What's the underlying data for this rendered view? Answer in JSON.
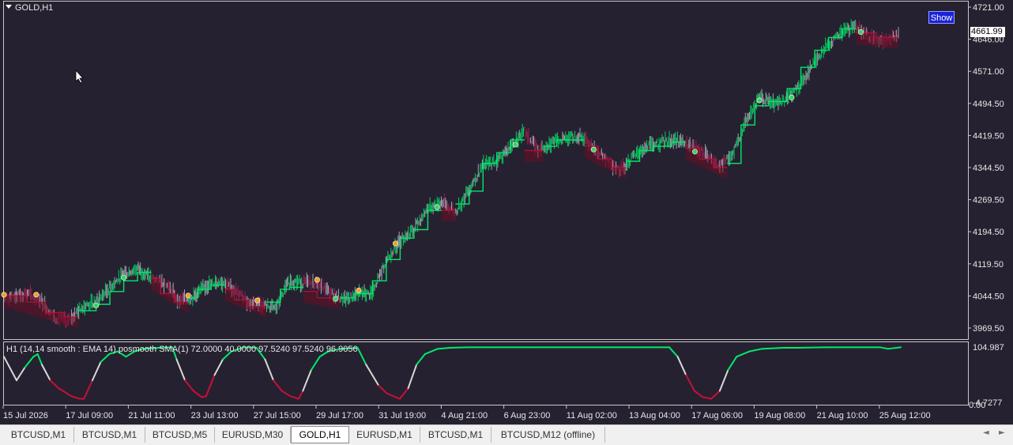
{
  "chart": {
    "symbol_label": "GOLD,H1",
    "indicator_label": "H1  (14,14 smooth : EMA  14) posmooth SMA(1) 72.0000 40.0000 97.5240 97.5240 96.9056",
    "show_button": "Show",
    "current_price": "4661.99",
    "y_ticks": [
      "4721.00",
      "4646.00",
      "4571.00",
      "4494.50",
      "4419.50",
      "4344.50",
      "4269.50",
      "4194.50",
      "4119.50",
      "4044.50",
      "3969.50"
    ],
    "sub_ticks": [
      "104.987",
      "-4.7277"
    ],
    "sub_zero": "0.00",
    "x_ticks": [
      "15 Jul 2026",
      "17 Jul 09:00",
      "21 Jul 11:00",
      "23 Jul 13:00",
      "27 Jul 15:00",
      "29 Jul 17:00",
      "31 Jul 19:00",
      "4 Aug 21:00",
      "6 Aug 23:00",
      "11 Aug 02:00",
      "13 Aug 04:00",
      "17 Aug 06:00",
      "19 Aug 08:00",
      "21 Aug 10:00",
      "25 Aug 12:00"
    ],
    "colors": {
      "background": "#262130",
      "up": "#00e86a",
      "down": "#c8103a",
      "neutral": "#b8b8c8",
      "signal_buy": "#40d060",
      "signal_sell": "#f0a020"
    }
  },
  "chart_data": {
    "type": "line",
    "y_range": [
      3950,
      4730
    ],
    "price_path": [
      [
        0,
        4040
      ],
      [
        5,
        4050
      ],
      [
        8,
        4035
      ],
      [
        11,
        3995
      ],
      [
        14,
        3985
      ],
      [
        17,
        4020
      ],
      [
        20,
        4030
      ],
      [
        23,
        4065
      ],
      [
        26,
        4095
      ],
      [
        29,
        4110
      ],
      [
        32,
        4085
      ],
      [
        35,
        4075
      ],
      [
        38,
        4035
      ],
      [
        41,
        4040
      ],
      [
        44,
        4070
      ],
      [
        47,
        4080
      ],
      [
        50,
        4060
      ],
      [
        53,
        4030
      ],
      [
        56,
        4025
      ],
      [
        59,
        4015
      ],
      [
        62,
        4080
      ],
      [
        65,
        4075
      ],
      [
        68,
        4075
      ],
      [
        71,
        4050
      ],
      [
        74,
        4035
      ],
      [
        77,
        4050
      ],
      [
        80,
        4050
      ],
      [
        83,
        4130
      ],
      [
        86,
        4175
      ],
      [
        89,
        4200
      ],
      [
        92,
        4250
      ],
      [
        95,
        4265
      ],
      [
        98,
        4240
      ],
      [
        101,
        4295
      ],
      [
        104,
        4350
      ],
      [
        107,
        4360
      ],
      [
        110,
        4395
      ],
      [
        113,
        4430
      ],
      [
        116,
        4385
      ],
      [
        119,
        4405
      ],
      [
        122,
        4415
      ],
      [
        125,
        4420
      ],
      [
        128,
        4395
      ],
      [
        131,
        4360
      ],
      [
        134,
        4340
      ],
      [
        137,
        4375
      ],
      [
        140,
        4395
      ],
      [
        143,
        4405
      ],
      [
        146,
        4410
      ],
      [
        149,
        4395
      ],
      [
        152,
        4380
      ],
      [
        155,
        4350
      ],
      [
        158,
        4370
      ],
      [
        161,
        4450
      ],
      [
        164,
        4510
      ],
      [
        167,
        4495
      ],
      [
        170,
        4505
      ],
      [
        173,
        4540
      ],
      [
        176,
        4595
      ],
      [
        179,
        4635
      ],
      [
        182,
        4660
      ],
      [
        185,
        4680
      ],
      [
        188,
        4650
      ],
      [
        191,
        4640
      ],
      [
        194,
        4655
      ]
    ],
    "trail_segments": [
      {
        "color": "down",
        "points": [
          [
            0,
            4045
          ],
          [
            5,
            4045
          ],
          [
            5,
            4030
          ],
          [
            9,
            4030
          ],
          [
            9,
            4005
          ],
          [
            13,
            4005
          ],
          [
            13,
            3995
          ],
          [
            16,
            3995
          ]
        ]
      },
      {
        "color": "up",
        "points": [
          [
            16,
            4010
          ],
          [
            20,
            4010
          ],
          [
            20,
            4025
          ],
          [
            23,
            4025
          ],
          [
            23,
            4055
          ],
          [
            26,
            4055
          ],
          [
            26,
            4080
          ],
          [
            29,
            4080
          ],
          [
            29,
            4100
          ],
          [
            32,
            4100
          ]
        ]
      },
      {
        "color": "down",
        "points": [
          [
            32,
            4085
          ],
          [
            34,
            4085
          ],
          [
            34,
            4050
          ],
          [
            37,
            4050
          ],
          [
            37,
            4030
          ],
          [
            40,
            4030
          ]
        ]
      },
      {
        "color": "up",
        "points": [
          [
            40,
            4040
          ],
          [
            42,
            4040
          ],
          [
            42,
            4060
          ],
          [
            45,
            4060
          ],
          [
            45,
            4070
          ],
          [
            48,
            4070
          ]
        ]
      },
      {
        "color": "down",
        "points": [
          [
            48,
            4060
          ],
          [
            50,
            4060
          ],
          [
            50,
            4035
          ],
          [
            53,
            4035
          ],
          [
            53,
            4020
          ],
          [
            57,
            4020
          ]
        ]
      },
      {
        "color": "up",
        "points": [
          [
            57,
            4030
          ],
          [
            60,
            4030
          ],
          [
            60,
            4060
          ],
          [
            62,
            4060
          ],
          [
            62,
            4065
          ],
          [
            65,
            4065
          ]
        ]
      },
      {
        "color": "down",
        "points": [
          [
            65,
            4055
          ],
          [
            68,
            4055
          ],
          [
            68,
            4040
          ],
          [
            73,
            4040
          ]
        ]
      },
      {
        "color": "up",
        "points": [
          [
            73,
            4040
          ],
          [
            76,
            4040
          ],
          [
            76,
            4050
          ],
          [
            80,
            4050
          ],
          [
            80,
            4080
          ],
          [
            83,
            4080
          ],
          [
            83,
            4130
          ],
          [
            86,
            4130
          ],
          [
            86,
            4180
          ],
          [
            89,
            4180
          ],
          [
            89,
            4200
          ],
          [
            92,
            4200
          ],
          [
            92,
            4245
          ],
          [
            95,
            4245
          ]
        ]
      },
      {
        "color": "down",
        "points": [
          [
            95,
            4245
          ],
          [
            98,
            4245
          ]
        ]
      },
      {
        "color": "up",
        "points": [
          [
            98,
            4260
          ],
          [
            101,
            4260
          ],
          [
            101,
            4290
          ],
          [
            104,
            4290
          ],
          [
            104,
            4355
          ],
          [
            107,
            4355
          ],
          [
            107,
            4380
          ],
          [
            110,
            4380
          ],
          [
            110,
            4410
          ],
          [
            113,
            4410
          ]
        ]
      },
      {
        "color": "down",
        "points": [
          [
            113,
            4385
          ],
          [
            117,
            4385
          ]
        ]
      },
      {
        "color": "up",
        "points": [
          [
            117,
            4395
          ],
          [
            120,
            4395
          ],
          [
            120,
            4410
          ],
          [
            126,
            4410
          ]
        ]
      },
      {
        "color": "down",
        "points": [
          [
            126,
            4395
          ],
          [
            129,
            4395
          ],
          [
            129,
            4365
          ],
          [
            132,
            4365
          ],
          [
            132,
            4345
          ],
          [
            135,
            4345
          ]
        ]
      },
      {
        "color": "up",
        "points": [
          [
            135,
            4360
          ],
          [
            138,
            4360
          ],
          [
            138,
            4385
          ],
          [
            141,
            4385
          ],
          [
            141,
            4395
          ],
          [
            145,
            4395
          ],
          [
            145,
            4405
          ],
          [
            148,
            4405
          ]
        ]
      },
      {
        "color": "down",
        "points": [
          [
            148,
            4390
          ],
          [
            151,
            4390
          ],
          [
            151,
            4365
          ],
          [
            154,
            4365
          ],
          [
            154,
            4345
          ],
          [
            157,
            4345
          ]
        ]
      },
      {
        "color": "up",
        "points": [
          [
            157,
            4355
          ],
          [
            160,
            4355
          ],
          [
            160,
            4445
          ],
          [
            163,
            4445
          ],
          [
            163,
            4490
          ],
          [
            166,
            4490
          ],
          [
            166,
            4500
          ],
          [
            170,
            4500
          ],
          [
            170,
            4530
          ],
          [
            173,
            4530
          ],
          [
            173,
            4580
          ],
          [
            176,
            4580
          ],
          [
            176,
            4620
          ],
          [
            179,
            4620
          ],
          [
            179,
            4650
          ],
          [
            182,
            4650
          ],
          [
            182,
            4670
          ],
          [
            185,
            4670
          ]
        ]
      },
      {
        "color": "down",
        "points": [
          [
            185,
            4660
          ],
          [
            189,
            4660
          ],
          [
            189,
            4650
          ],
          [
            194,
            4650
          ]
        ]
      }
    ],
    "signals": [
      {
        "i": 0,
        "type": "sell"
      },
      {
        "i": 7,
        "type": "sell"
      },
      {
        "i": 20,
        "type": "buy"
      },
      {
        "i": 26,
        "type": "buy"
      },
      {
        "i": 40,
        "type": "sell"
      },
      {
        "i": 55,
        "type": "sell"
      },
      {
        "i": 68,
        "type": "sell"
      },
      {
        "i": 72,
        "type": "buy"
      },
      {
        "i": 77,
        "type": "sell"
      },
      {
        "i": 85,
        "type": "sell"
      },
      {
        "i": 94,
        "type": "buy"
      },
      {
        "i": 111,
        "type": "buy"
      },
      {
        "i": 128,
        "type": "buy"
      },
      {
        "i": 150,
        "type": "buy"
      },
      {
        "i": 164,
        "type": "buy"
      },
      {
        "i": 171,
        "type": "buy"
      },
      {
        "i": 186,
        "type": "buy"
      }
    ],
    "oscillator_range": [
      -4.7277,
      104.987
    ],
    "oscillator": [
      [
        0,
        85
      ],
      [
        2,
        55
      ],
      [
        3,
        40
      ],
      [
        5,
        65
      ],
      [
        7,
        85
      ],
      [
        8,
        90
      ],
      [
        9,
        70
      ],
      [
        11,
        40
      ],
      [
        13,
        25
      ],
      [
        16,
        10
      ],
      [
        18,
        5
      ],
      [
        19,
        5
      ],
      [
        21,
        40
      ],
      [
        23,
        75
      ],
      [
        25,
        90
      ],
      [
        27,
        95
      ],
      [
        29,
        85
      ],
      [
        31,
        95
      ],
      [
        33,
        100
      ],
      [
        37,
        102
      ],
      [
        40,
        103
      ],
      [
        41,
        80
      ],
      [
        43,
        40
      ],
      [
        45,
        20
      ],
      [
        47,
        8
      ],
      [
        48,
        10
      ],
      [
        50,
        50
      ],
      [
        52,
        80
      ],
      [
        54,
        95
      ],
      [
        57,
        103
      ],
      [
        60,
        102
      ],
      [
        62,
        80
      ],
      [
        64,
        40
      ],
      [
        66,
        20
      ],
      [
        68,
        10
      ],
      [
        70,
        5
      ],
      [
        71,
        20
      ],
      [
        73,
        60
      ],
      [
        75,
        85
      ],
      [
        77,
        95
      ],
      [
        80,
        100
      ],
      [
        84,
        102
      ],
      [
        86,
        70
      ],
      [
        89,
        30
      ],
      [
        91,
        15
      ],
      [
        94,
        5
      ],
      [
        96,
        25
      ],
      [
        98,
        70
      ],
      [
        100,
        90
      ],
      [
        103,
        100
      ],
      [
        106,
        102
      ],
      [
        110,
        103
      ],
      [
        115,
        103
      ],
      [
        125,
        103
      ],
      [
        150,
        103
      ],
      [
        158,
        103
      ],
      [
        160,
        85
      ],
      [
        162,
        50
      ],
      [
        164,
        20
      ],
      [
        166,
        8
      ],
      [
        168,
        5
      ],
      [
        170,
        20
      ],
      [
        172,
        60
      ],
      [
        174,
        85
      ],
      [
        177,
        95
      ],
      [
        180,
        100
      ],
      [
        185,
        102
      ],
      [
        189,
        102
      ],
      [
        195,
        103
      ],
      [
        208,
        103
      ],
      [
        210,
        100
      ],
      [
        213,
        103
      ]
    ],
    "oscillator_colors": [
      "up",
      "down",
      "neutral"
    ]
  },
  "tabs": [
    {
      "label": "BTCUSD,M1",
      "active": false
    },
    {
      "label": "BTCUSD,M1",
      "active": false
    },
    {
      "label": "BTCUSD,M5",
      "active": false
    },
    {
      "label": "EURUSD,M30",
      "active": false
    },
    {
      "label": "GOLD,H1",
      "active": true
    },
    {
      "label": "EURUSD,M1",
      "active": false
    },
    {
      "label": "BTCUSD,M1",
      "active": false
    },
    {
      "label": "BTCUSD,M12 (offline)",
      "active": false
    }
  ],
  "tab_nav": {
    "left_icon": "◄",
    "right_icon": "►"
  }
}
